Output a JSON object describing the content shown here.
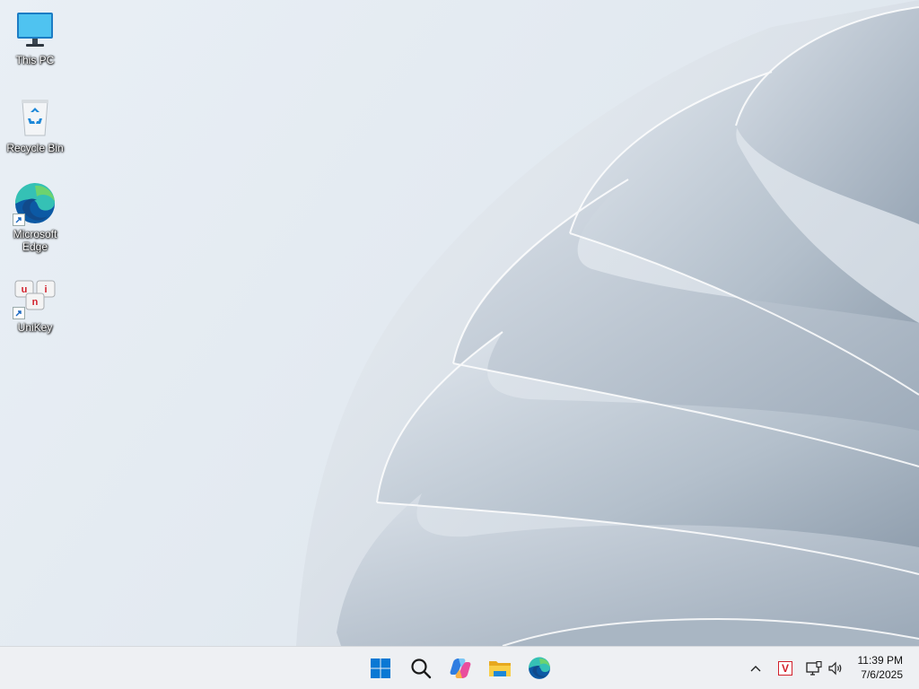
{
  "desktop": {
    "icons": [
      {
        "label": "This PC",
        "icon": "computer-monitor-icon"
      },
      {
        "label": "Recycle Bin",
        "icon": "recycle-bin-icon"
      },
      {
        "label": "Microsoft Edge",
        "icon": "edge-icon"
      },
      {
        "label": "UniKey",
        "icon": "unikey-icon"
      }
    ]
  },
  "taskbar": {
    "buttons": [
      {
        "name": "Start",
        "icon": "windows-logo-icon"
      },
      {
        "name": "Search",
        "icon": "search-icon"
      },
      {
        "name": "Copilot",
        "icon": "copilot-icon"
      },
      {
        "name": "File Explorer",
        "icon": "folder-icon"
      },
      {
        "name": "Microsoft Edge",
        "icon": "edge-icon"
      }
    ],
    "tray": {
      "overflow_glyph": "^",
      "unikey_badge": "V",
      "time": "11:39 PM",
      "date": "7/6/2025"
    }
  },
  "colors": {
    "start_blue": "#0a78d4",
    "unikey_red": "#d21f2a",
    "taskbar_bg": "#eef0f3"
  }
}
